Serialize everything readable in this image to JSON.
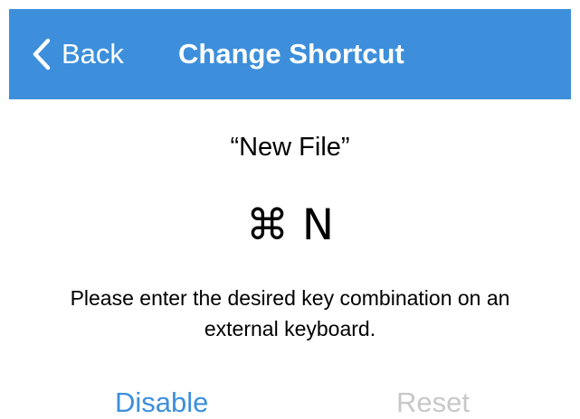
{
  "colors": {
    "navbar_bg": "#3d8fdb",
    "accent": "#3d8fdb",
    "disabled": "#c8c8c8"
  },
  "navbar": {
    "back_icon": "chevron-left-icon",
    "back_label": "Back",
    "title": "Change Shortcut"
  },
  "shortcut": {
    "name": "“New File”",
    "keys": "⌘ N"
  },
  "instructions": {
    "line1": "Please enter the desired key combination on an",
    "line2": "external keyboard."
  },
  "actions": {
    "disable_label": "Disable",
    "reset_label": "Reset",
    "reset_enabled": false
  }
}
